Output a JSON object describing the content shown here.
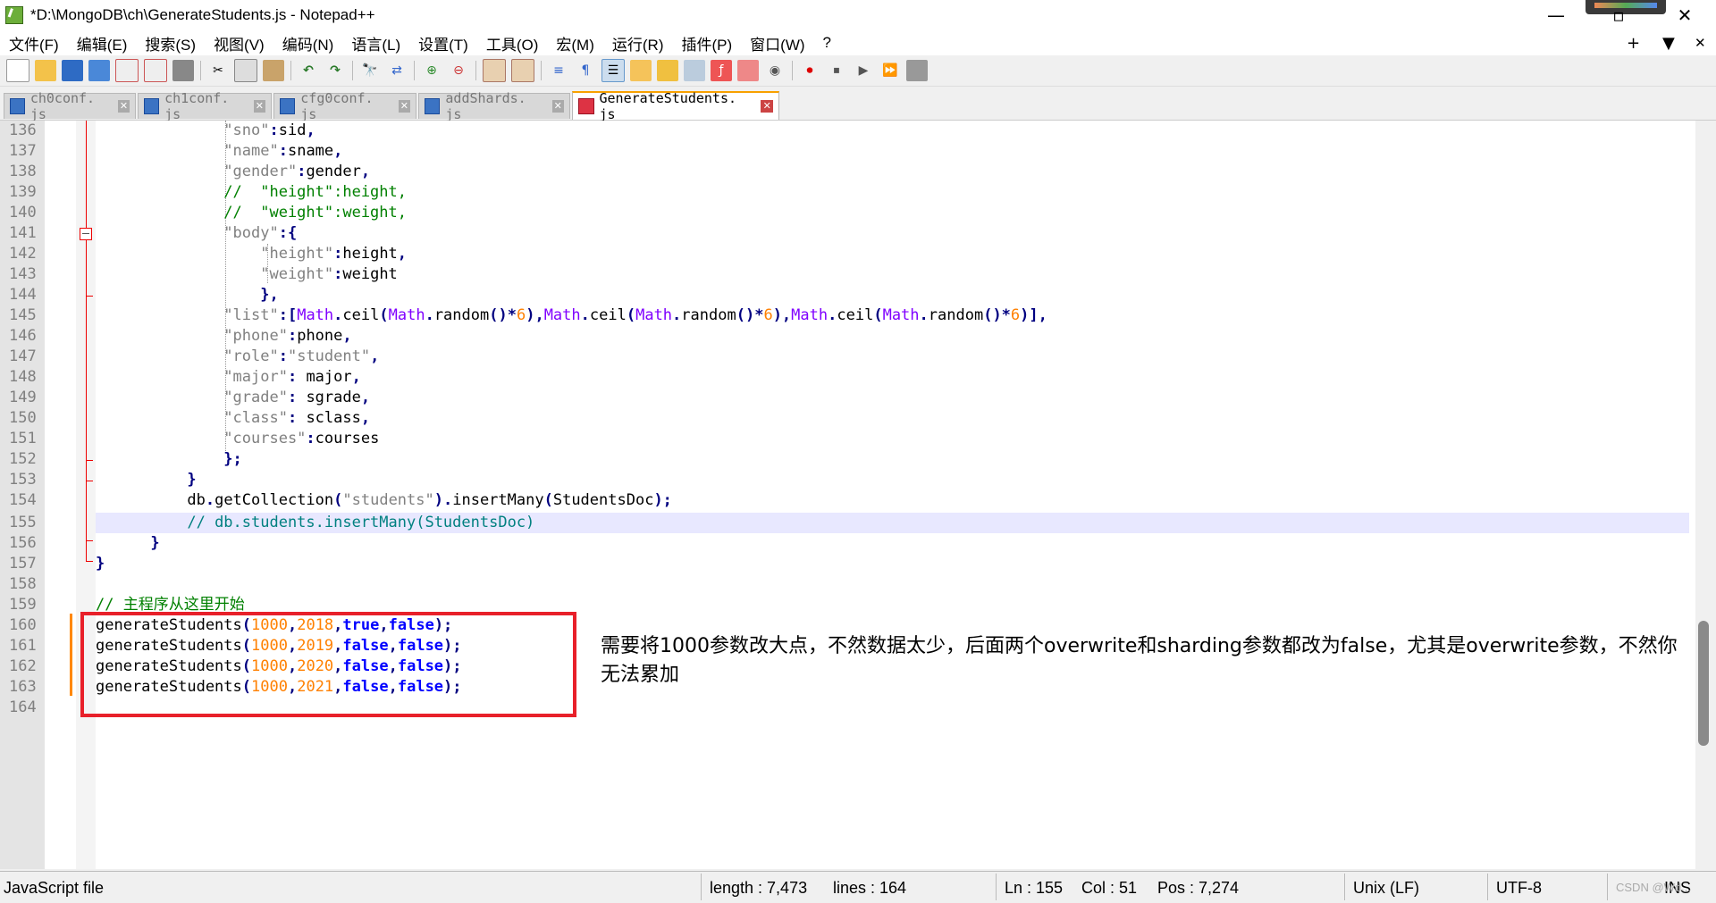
{
  "window": {
    "title": "*D:\\MongoDB\\ch\\GenerateStudents.js - Notepad++",
    "minimize": "—",
    "maximize": "▫",
    "close": "✕"
  },
  "menu": {
    "items": [
      "文件(F)",
      "编辑(E)",
      "搜索(S)",
      "视图(V)",
      "编码(N)",
      "语言(L)",
      "设置(T)",
      "工具(O)",
      "宏(M)",
      "运行(R)",
      "插件(P)",
      "窗口(W)",
      "?"
    ],
    "right_plus": "+",
    "right_dropdown": "▼",
    "right_close": "✕"
  },
  "toolbar": {
    "icons": [
      "new-file-icon",
      "open-file-icon",
      "save-icon",
      "save-all-icon",
      "close-icon",
      "close-all-icon",
      "print-icon",
      "cut-icon",
      "copy-icon",
      "paste-icon",
      "undo-icon",
      "redo-icon",
      "find-icon",
      "replace-icon",
      "zoom-in-icon",
      "zoom-out-icon",
      "sync-vertical-icon",
      "sync-horizontal-icon",
      "word-wrap-icon",
      "show-all-chars-icon",
      "indent-guide-icon",
      "language-icon",
      "doc-map-icon",
      "function-list-icon",
      "folder-workspace-icon",
      "monitoring-icon",
      "record-macro-icon",
      "stop-record-icon",
      "play-macro-icon",
      "run-macro-multiple-icon",
      "save-macro-icon"
    ]
  },
  "tabs": [
    {
      "label": "ch0conf. js",
      "active": false
    },
    {
      "label": "ch1conf. js",
      "active": false
    },
    {
      "label": "cfg0conf. js",
      "active": false
    },
    {
      "label": "addShards. js",
      "active": false
    },
    {
      "label": "GenerateStudents. js",
      "active": true
    }
  ],
  "editor": {
    "line_numbers": [
      "136",
      "137",
      "138",
      "139",
      "140",
      "141",
      "142",
      "143",
      "144",
      "145",
      "146",
      "147",
      "148",
      "149",
      "150",
      "151",
      "152",
      "153",
      "154",
      "155",
      "156",
      "157",
      "158",
      "159",
      "160",
      "161",
      "162",
      "163",
      "164"
    ]
  },
  "annotation": {
    "text": "需要将1000参数改大点，不然数据太少，后面两个overwrite和sharding参数都改为false，尤其是overwrite参数，不然你无法累加"
  },
  "status": {
    "file_type": "JavaScript file",
    "length": "length : 7,473",
    "lines": "lines : 164",
    "ln": "Ln : 155",
    "col": "Col : 51",
    "pos": "Pos : 7,274",
    "eol": "Unix (LF)",
    "encoding": "UTF-8",
    "mode": "INS",
    "watermark": "CSDN @Wd..."
  }
}
